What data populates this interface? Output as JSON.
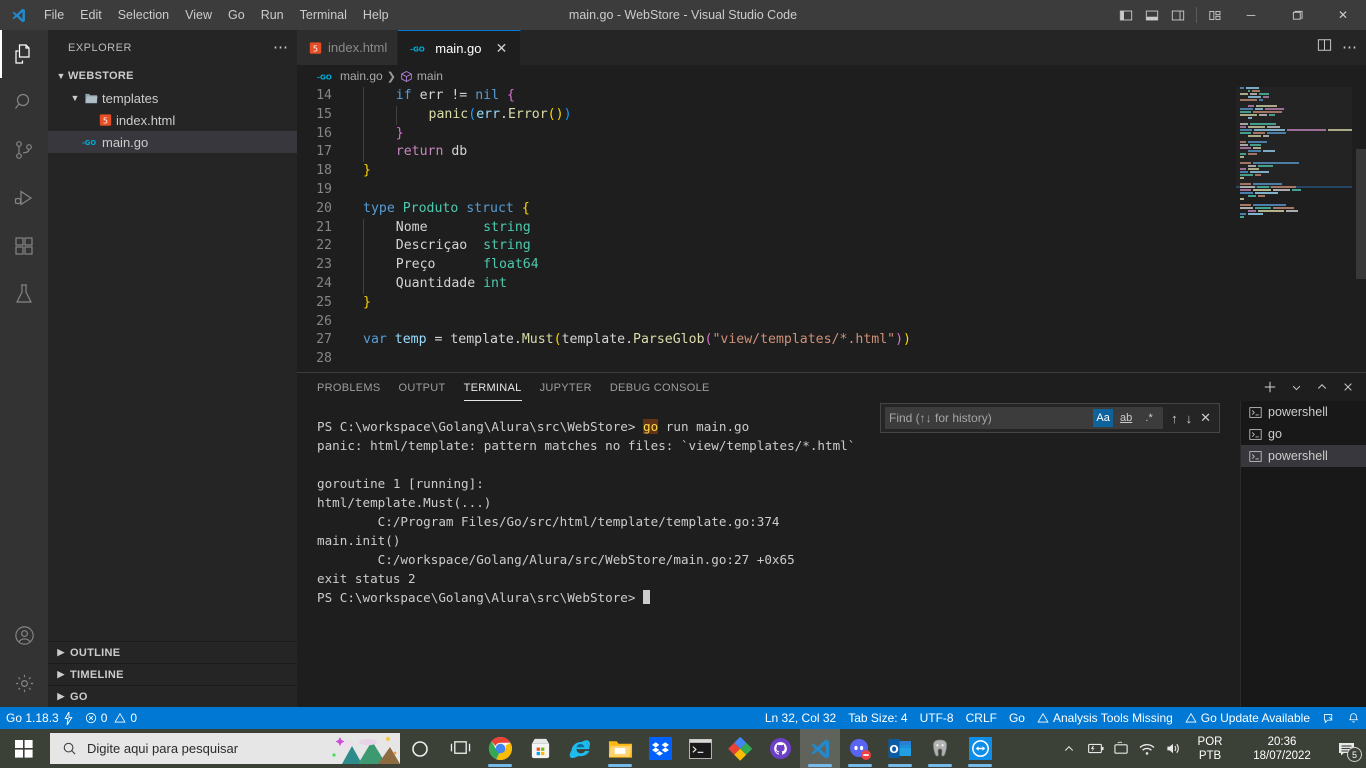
{
  "titlebar": {
    "menus": [
      "File",
      "Edit",
      "Selection",
      "View",
      "Go",
      "Run",
      "Terminal",
      "Help"
    ],
    "window_title": "main.go - WebStore - Visual Studio Code",
    "layout_buttons": [
      "toggle-primary-sidebar",
      "toggle-panel",
      "toggle-secondary-sidebar",
      "customize-layout"
    ],
    "window_buttons": {
      "minimize": "─",
      "maximize": "❐",
      "close": "✕"
    }
  },
  "activitybar": {
    "items": [
      {
        "name": "explorer",
        "active": true
      },
      {
        "name": "search",
        "active": false
      },
      {
        "name": "source-control",
        "active": false
      },
      {
        "name": "run-and-debug",
        "active": false
      },
      {
        "name": "extensions",
        "active": false
      },
      {
        "name": "testing",
        "active": false
      }
    ],
    "bottom": [
      {
        "name": "accounts"
      },
      {
        "name": "manage-settings"
      }
    ]
  },
  "sidebar": {
    "title": "EXPLORER",
    "root": "WEBSTORE",
    "tree": [
      {
        "label": "templates",
        "indent": 1,
        "type": "folder",
        "expanded": true,
        "selected": false
      },
      {
        "label": "index.html",
        "indent": 2,
        "type": "html",
        "expanded": false,
        "selected": false
      },
      {
        "label": "main.go",
        "indent": 1,
        "type": "go",
        "expanded": false,
        "selected": true
      }
    ],
    "sections": [
      "OUTLINE",
      "TIMELINE",
      "GO"
    ]
  },
  "editor": {
    "tabs": [
      {
        "label": "index.html",
        "icon": "html-icon",
        "active": false,
        "closable": false
      },
      {
        "label": "main.go",
        "icon": "go-icon",
        "active": true,
        "closable": true
      }
    ],
    "breadcrumbs": [
      {
        "label": "main.go",
        "icon": "go-icon"
      },
      {
        "label": "main",
        "icon": "symbol-package-icon"
      }
    ],
    "actions": [
      "split-editor-icon",
      "more-actions-icon"
    ],
    "lines": [
      {
        "num": "14",
        "indent": 1,
        "guides": 1,
        "tokens": [
          {
            "t": "if ",
            "c": "c-kw"
          },
          {
            "t": "err ",
            "c": "c-pl"
          },
          {
            "t": "!= ",
            "c": "c-pl"
          },
          {
            "t": "nil",
            "c": "c-nil"
          },
          {
            "t": " ",
            "c": "c-pl"
          },
          {
            "t": "{",
            "c": "c-br2"
          }
        ]
      },
      {
        "num": "15",
        "indent": 2,
        "guides": 2,
        "tokens": [
          {
            "t": "panic",
            "c": "c-fn"
          },
          {
            "t": "(",
            "c": "c-br3"
          },
          {
            "t": "err",
            "c": "c-var"
          },
          {
            "t": ".",
            "c": "c-pl"
          },
          {
            "t": "Error",
            "c": "c-fn"
          },
          {
            "t": "()",
            "c": "c-br1"
          },
          {
            "t": ")",
            "c": "c-br3"
          }
        ]
      },
      {
        "num": "16",
        "indent": 1,
        "guides": 1,
        "tokens": [
          {
            "t": "}",
            "c": "c-br2"
          }
        ]
      },
      {
        "num": "17",
        "indent": 1,
        "guides": 1,
        "tokens": [
          {
            "t": "return ",
            "c": "c-kw2"
          },
          {
            "t": "db",
            "c": "c-pl"
          }
        ]
      },
      {
        "num": "18",
        "indent": 0,
        "guides": 0,
        "tokens": [
          {
            "t": "}",
            "c": "c-br1"
          }
        ]
      },
      {
        "num": "19",
        "indent": 0,
        "guides": 0,
        "tokens": []
      },
      {
        "num": "20",
        "indent": 0,
        "guides": 0,
        "tokens": [
          {
            "t": "type ",
            "c": "c-kw"
          },
          {
            "t": "Produto ",
            "c": "c-type"
          },
          {
            "t": "struct ",
            "c": "c-kw"
          },
          {
            "t": "{",
            "c": "c-br1"
          }
        ]
      },
      {
        "num": "21",
        "indent": 1,
        "guides": 1,
        "tokens": [
          {
            "t": "Nome       ",
            "c": "c-pl"
          },
          {
            "t": "string",
            "c": "c-type"
          }
        ]
      },
      {
        "num": "22",
        "indent": 1,
        "guides": 1,
        "tokens": [
          {
            "t": "Descriçao  ",
            "c": "c-pl"
          },
          {
            "t": "string",
            "c": "c-type"
          }
        ]
      },
      {
        "num": "23",
        "indent": 1,
        "guides": 1,
        "tokens": [
          {
            "t": "Preço      ",
            "c": "c-pl"
          },
          {
            "t": "float64",
            "c": "c-type"
          }
        ]
      },
      {
        "num": "24",
        "indent": 1,
        "guides": 1,
        "tokens": [
          {
            "t": "Quantidade ",
            "c": "c-pl"
          },
          {
            "t": "int",
            "c": "c-type"
          }
        ]
      },
      {
        "num": "25",
        "indent": 0,
        "guides": 0,
        "tokens": [
          {
            "t": "}",
            "c": "c-br1"
          }
        ]
      },
      {
        "num": "26",
        "indent": 0,
        "guides": 0,
        "tokens": []
      },
      {
        "num": "27",
        "indent": 0,
        "guides": 0,
        "tokens": [
          {
            "t": "var ",
            "c": "c-kw"
          },
          {
            "t": "temp ",
            "c": "c-var"
          },
          {
            "t": "= ",
            "c": "c-pl"
          },
          {
            "t": "template",
            "c": "c-pl"
          },
          {
            "t": ".",
            "c": "c-pl"
          },
          {
            "t": "Must",
            "c": "c-fn"
          },
          {
            "t": "(",
            "c": "c-br1"
          },
          {
            "t": "template",
            "c": "c-pl"
          },
          {
            "t": ".",
            "c": "c-pl"
          },
          {
            "t": "ParseGlob",
            "c": "c-fn"
          },
          {
            "t": "(",
            "c": "c-br2"
          },
          {
            "t": "\"view/templates/*.html\"",
            "c": "c-str"
          },
          {
            "t": ")",
            "c": "c-br2"
          },
          {
            "t": ")",
            "c": "c-br1"
          }
        ]
      },
      {
        "num": "28",
        "indent": 0,
        "guides": 0,
        "tokens": []
      }
    ]
  },
  "panel": {
    "tabs": [
      {
        "label": "PROBLEMS",
        "active": false
      },
      {
        "label": "OUTPUT",
        "active": false
      },
      {
        "label": "TERMINAL",
        "active": true
      },
      {
        "label": "JUPYTER",
        "active": false
      },
      {
        "label": "DEBUG CONSOLE",
        "active": false
      }
    ],
    "actions": [
      "new-terminal-icon",
      "terminal-dropdown-icon",
      "maximize-panel-icon",
      "close-panel-icon"
    ],
    "find": {
      "placeholder": "Find (↑↓ for history)",
      "value": "",
      "options": [
        {
          "name": "match-case",
          "label": "Aa",
          "on": true
        },
        {
          "name": "match-whole-word",
          "label": "ab",
          "on": false
        },
        {
          "name": "use-regex",
          "label": ".*",
          "on": false
        }
      ],
      "nav": [
        "previous-match-icon",
        "next-match-icon",
        "close-find-icon"
      ]
    },
    "terminal_lines": [
      {
        "segments": [
          {
            "t": "PS C:\\workspace\\Golang\\Alura\\src\\WebStore> ",
            "s": "plain"
          },
          {
            "t": "go",
            "s": "match"
          },
          {
            "t": " run main.go",
            "s": "plain"
          }
        ]
      },
      {
        "segments": [
          {
            "t": "panic: html/template: pattern matches no files: `view/templates/*.html`",
            "s": "plain"
          }
        ]
      },
      {
        "segments": [
          {
            "t": "",
            "s": "plain"
          }
        ]
      },
      {
        "segments": [
          {
            "t": "goroutine 1 [running]:",
            "s": "plain"
          }
        ]
      },
      {
        "segments": [
          {
            "t": "html/template.Must(...)",
            "s": "plain"
          }
        ]
      },
      {
        "segments": [
          {
            "t": "        C:/Program Files/Go/src/html/template/template.go:374",
            "s": "plain"
          }
        ]
      },
      {
        "segments": [
          {
            "t": "main.init()",
            "s": "plain"
          }
        ]
      },
      {
        "segments": [
          {
            "t": "        C:/workspace/Golang/Alura/src/WebStore/main.go:27 +0x65",
            "s": "plain"
          }
        ]
      },
      {
        "segments": [
          {
            "t": "exit status 2",
            "s": "plain"
          }
        ]
      },
      {
        "segments": [
          {
            "t": "PS C:\\workspace\\Golang\\Alura\\src\\WebStore> ",
            "s": "plain"
          },
          {
            "t": "",
            "s": "cursor"
          }
        ]
      }
    ],
    "terminal_list": [
      {
        "label": "powershell",
        "active": false
      },
      {
        "label": "go",
        "active": false
      },
      {
        "label": "powershell",
        "active": true
      }
    ]
  },
  "statusbar": {
    "left": [
      {
        "name": "go-version",
        "label": "Go 1.18.3",
        "icon": "radio-tower-icon"
      },
      {
        "name": "problems",
        "label": "0",
        "label2": "0",
        "icon": "error-icon",
        "icon2": "warning-icon"
      }
    ],
    "right": [
      {
        "name": "cursor-position",
        "label": "Ln 32, Col 32"
      },
      {
        "name": "indentation",
        "label": "Tab Size: 4"
      },
      {
        "name": "encoding",
        "label": "UTF-8"
      },
      {
        "name": "eol",
        "label": "CRLF"
      },
      {
        "name": "language-mode",
        "label": "Go"
      },
      {
        "name": "analysis-tools-missing",
        "label": "Analysis Tools Missing",
        "icon": "warning-icon"
      },
      {
        "name": "go-update-available",
        "label": "Go Update Available",
        "icon": "warning-icon"
      },
      {
        "name": "remote-indicator",
        "label": "",
        "icon": "feedback-icon"
      },
      {
        "name": "notifications",
        "label": "",
        "icon": "bell-icon"
      }
    ]
  },
  "taskbar": {
    "search_placeholder": "Digite aqui para pesquisar",
    "icons": [
      {
        "name": "cortana-icon",
        "running": false
      },
      {
        "name": "task-view-icon",
        "running": false
      },
      {
        "name": "google-chrome-icon",
        "running": true
      },
      {
        "name": "microsoft-store-icon",
        "running": false
      },
      {
        "name": "internet-explorer-icon",
        "running": false
      },
      {
        "name": "file-explorer-icon",
        "running": true
      },
      {
        "name": "dropbox-icon",
        "running": false
      },
      {
        "name": "windows-terminal-icon",
        "running": false
      },
      {
        "name": "colorful-app-icon",
        "running": false
      },
      {
        "name": "github-desktop-icon",
        "running": false
      },
      {
        "name": "visual-studio-code-icon",
        "running": true,
        "active": true
      },
      {
        "name": "discord-icon",
        "running": true
      },
      {
        "name": "outlook-icon",
        "running": true
      },
      {
        "name": "postgresql-icon",
        "running": true
      },
      {
        "name": "teamviewer-icon",
        "running": true
      }
    ],
    "tray": {
      "language_top": "POR",
      "language_bottom": "PTB",
      "time": "20:36",
      "date": "18/07/2022",
      "notification_count": "5"
    }
  }
}
